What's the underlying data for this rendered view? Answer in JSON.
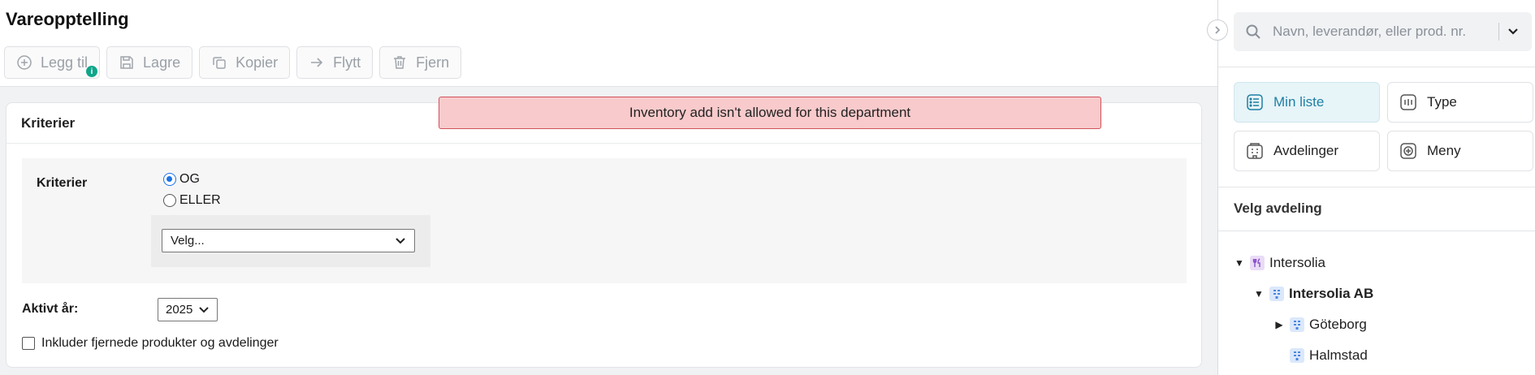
{
  "page": {
    "title": "Vareopptelling"
  },
  "toolbar": {
    "add": "Legg til",
    "add_badge": "i",
    "save": "Lagre",
    "copy": "Kopier",
    "move": "Flytt",
    "remove": "Fjern"
  },
  "alert": {
    "text": "Inventory add isn't allowed for this department"
  },
  "criteria_card": {
    "header": "Kriterier",
    "label": "Kriterier",
    "options": [
      "OG",
      "ELLER"
    ],
    "selected_option": "OG",
    "select_value": "Velg...",
    "active_year_label": "Aktivt år:",
    "active_year": "2025",
    "include_removed_label": "Inkluder fjernede produkter og avdelinger",
    "include_removed_checked": false
  },
  "sidebar": {
    "search_placeholder": "Navn, leverandør, eller prod. nr.",
    "nav": [
      {
        "label": "Min liste",
        "icon": "list-icon",
        "active": true
      },
      {
        "label": "Type",
        "icon": "type-icon",
        "active": false
      },
      {
        "label": "Avdelinger",
        "icon": "departments-icon",
        "active": false
      },
      {
        "label": "Meny",
        "icon": "menu-icon",
        "active": false
      }
    ],
    "section_title": "Velg avdeling",
    "tree": [
      {
        "label": "Intersolia",
        "expanded": true,
        "bold": false,
        "icon": "restaurant-icon"
      },
      {
        "label": "Intersolia AB",
        "expanded": true,
        "bold": true,
        "icon": "building-icon"
      },
      {
        "label": "Göteborg",
        "expanded": false,
        "bold": false,
        "icon": "building-icon"
      },
      {
        "label": "Halmstad",
        "expanded": null,
        "bold": false,
        "icon": "building-icon"
      }
    ]
  },
  "colors": {
    "accent": "#1e7fa3",
    "alert_bg": "#f8cacb",
    "alert_border": "#d2525b",
    "badge": "#10a58a"
  }
}
